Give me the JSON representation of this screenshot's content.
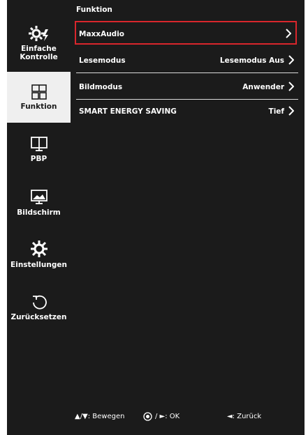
{
  "sidebar": {
    "items": [
      {
        "label_line1": "Einfache",
        "label_line2": "Kontrolle",
        "icon": "settings-quick-icon"
      },
      {
        "label": "Funktion",
        "icon": "grid-icon"
      },
      {
        "label": "PBP",
        "icon": "pbp-icon"
      },
      {
        "label": "Bildschirm",
        "icon": "picture-icon"
      },
      {
        "label": "Einstellungen",
        "icon": "gear-icon"
      },
      {
        "label": "Zurücksetzen",
        "icon": "reset-icon"
      }
    ]
  },
  "main": {
    "title": "Funktion",
    "rows": [
      {
        "label": "MaxxAudio",
        "value": ""
      },
      {
        "label": "Lesemodus",
        "value": "Lesemodus Aus"
      },
      {
        "label": "Bildmodus",
        "value": "Anwender"
      },
      {
        "label": "SMART ENERGY SAVING",
        "value": "Tief"
      }
    ]
  },
  "footer": {
    "move": "▲/▼: Bewegen",
    "ok": "/ ►: OK",
    "back": "◄: Zurück"
  },
  "colors": {
    "background": "#1b1b1b",
    "selection": "#d9262c",
    "active_tab": "#efefef"
  }
}
